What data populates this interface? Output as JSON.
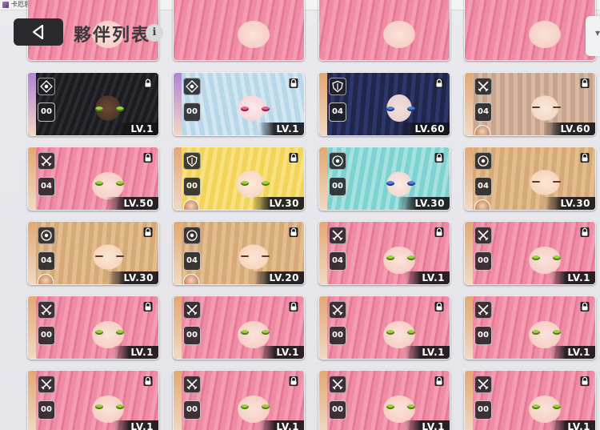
{
  "window": {
    "title": "卡厄思梦境"
  },
  "header": {
    "title": "夥伴列表",
    "info_label": "i"
  },
  "companions": [
    {
      "level": "LV.1",
      "rank": "00",
      "class": "eye-icon",
      "art": "art-dark",
      "eyes": "eyes-green",
      "lbar": "#b184d6",
      "avatar": false
    },
    {
      "level": "LV.1",
      "rank": "00",
      "class": "eye-icon",
      "art": "art-silver",
      "eyes": "eyes-pink",
      "lbar": "#b184d6",
      "avatar": false
    },
    {
      "level": "LV.60",
      "rank": "04",
      "class": "shield-icon",
      "art": "art-navy",
      "eyes": "eyes-blue",
      "lbar": "#e3a873",
      "avatar": false
    },
    {
      "level": "LV.60",
      "rank": "04",
      "class": "crossed-swords-icon",
      "art": "art-brown",
      "eyes": "eyes-closed",
      "lbar": "#e3a873",
      "avatar": true
    },
    {
      "level": "LV.50",
      "rank": "04",
      "class": "crossed-swords-icon",
      "art": "art-pink",
      "eyes": "eyes-green",
      "lbar": "#e3a873",
      "avatar": false
    },
    {
      "level": "LV.30",
      "rank": "00",
      "class": "shield-icon",
      "art": "art-blonde",
      "eyes": "eyes-green",
      "lbar": "#e3a873",
      "avatar": true
    },
    {
      "level": "LV.30",
      "rank": "00",
      "class": "target-icon",
      "art": "art-teal",
      "eyes": "eyes-blue",
      "lbar": "#e3a873",
      "avatar": false
    },
    {
      "level": "LV.30",
      "rank": "04",
      "class": "target-icon",
      "art": "art-tan",
      "eyes": "eyes-closed",
      "lbar": "#e3a873",
      "avatar": true
    },
    {
      "level": "LV.30",
      "rank": "04",
      "class": "target-icon",
      "art": "art-tan",
      "eyes": "eyes-closed",
      "lbar": "#e3a873",
      "avatar": true
    },
    {
      "level": "LV.20",
      "rank": "04",
      "class": "target-icon",
      "art": "art-tan",
      "eyes": "eyes-closed",
      "lbar": "#e3a873",
      "avatar": true
    },
    {
      "level": "LV.1",
      "rank": "04",
      "class": "crossed-swords-icon",
      "art": "art-pink",
      "eyes": "eyes-green",
      "lbar": "#e3a873",
      "avatar": false
    },
    {
      "level": "LV.1",
      "rank": "00",
      "class": "crossed-swords-icon",
      "art": "art-pink",
      "eyes": "eyes-green",
      "lbar": "#e3a873",
      "avatar": false
    },
    {
      "level": "LV.1",
      "rank": "00",
      "class": "crossed-swords-icon",
      "art": "art-pink",
      "eyes": "eyes-green",
      "lbar": "#e3a873",
      "avatar": false
    },
    {
      "level": "LV.1",
      "rank": "00",
      "class": "crossed-swords-icon",
      "art": "art-pink",
      "eyes": "eyes-green",
      "lbar": "#e3a873",
      "avatar": false
    },
    {
      "level": "LV.1",
      "rank": "00",
      "class": "crossed-swords-icon",
      "art": "art-pink",
      "eyes": "eyes-green",
      "lbar": "#e3a873",
      "avatar": false
    },
    {
      "level": "LV.1",
      "rank": "00",
      "class": "crossed-swords-icon",
      "art": "art-pink",
      "eyes": "eyes-green",
      "lbar": "#e3a873",
      "avatar": false
    },
    {
      "level": "LV.1",
      "rank": "00",
      "class": "crossed-swords-icon",
      "art": "art-pink",
      "eyes": "eyes-green",
      "lbar": "#e3a873",
      "avatar": false
    },
    {
      "level": "LV.1",
      "rank": "00",
      "class": "crossed-swords-icon",
      "art": "art-pink",
      "eyes": "eyes-green",
      "lbar": "#e3a873",
      "avatar": false
    },
    {
      "level": "LV.1",
      "rank": "00",
      "class": "crossed-swords-icon",
      "art": "art-pink",
      "eyes": "eyes-green",
      "lbar": "#e3a873",
      "avatar": false
    },
    {
      "level": "LV.1",
      "rank": "00",
      "class": "crossed-swords-icon",
      "art": "art-pink",
      "eyes": "eyes-green",
      "lbar": "#e3a873",
      "avatar": false
    }
  ]
}
